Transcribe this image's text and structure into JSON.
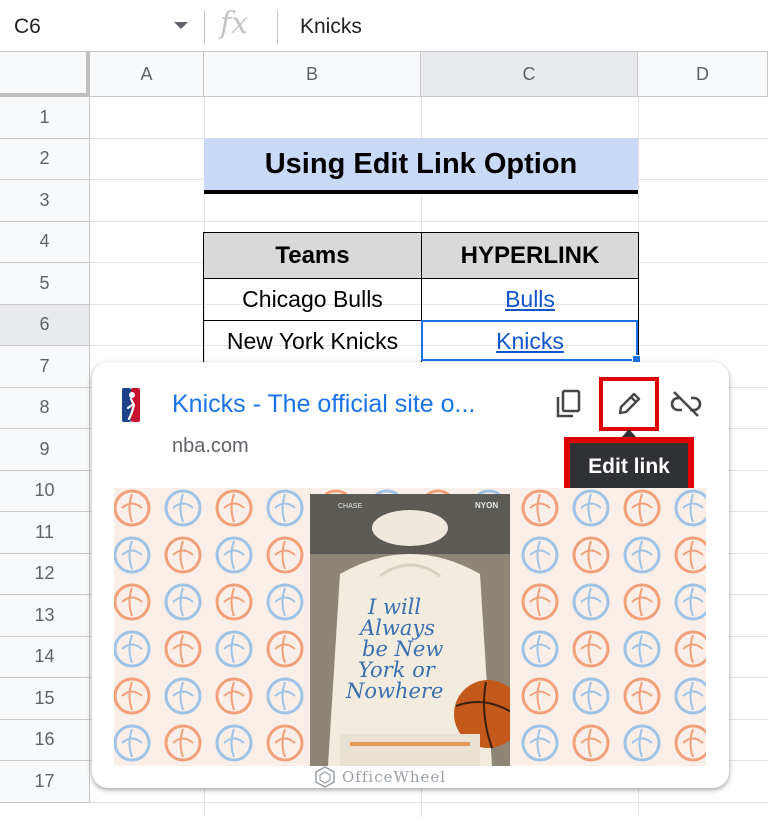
{
  "formula_bar": {
    "cell_ref": "C6",
    "fx_symbol": "fx",
    "content": "Knicks"
  },
  "columns": [
    "A",
    "B",
    "C",
    "D"
  ],
  "rows": [
    "1",
    "2",
    "3",
    "4",
    "5",
    "6",
    "7",
    "8",
    "9",
    "10",
    "11",
    "12",
    "13",
    "14",
    "15",
    "16",
    "17"
  ],
  "active_cell": "C6",
  "sheet": {
    "title": "Using Edit Link Option",
    "table": {
      "headers": [
        "Teams",
        "HYPERLINK"
      ],
      "rows": [
        [
          "Chicago Bulls",
          "Bulls"
        ],
        [
          "New York Knicks",
          "Knicks"
        ]
      ]
    }
  },
  "link_card": {
    "title": "Knicks - The official site o...",
    "domain": "nba.com",
    "tooltip": "Edit link",
    "icons": [
      "nba-logo-icon",
      "copy-icon",
      "edit-pencil-icon",
      "unlink-icon"
    ],
    "preview_text": "I'll Always be New York or Nowhere",
    "preview_badges": [
      "CHASE",
      "NYON"
    ]
  },
  "watermark": "OfficeWheel",
  "colors": {
    "title_fill": "#c9daf8",
    "header_fill": "#d9d9d9",
    "link": "#1155cc",
    "selection": "#1a73e8",
    "highlight": "#e00000"
  }
}
